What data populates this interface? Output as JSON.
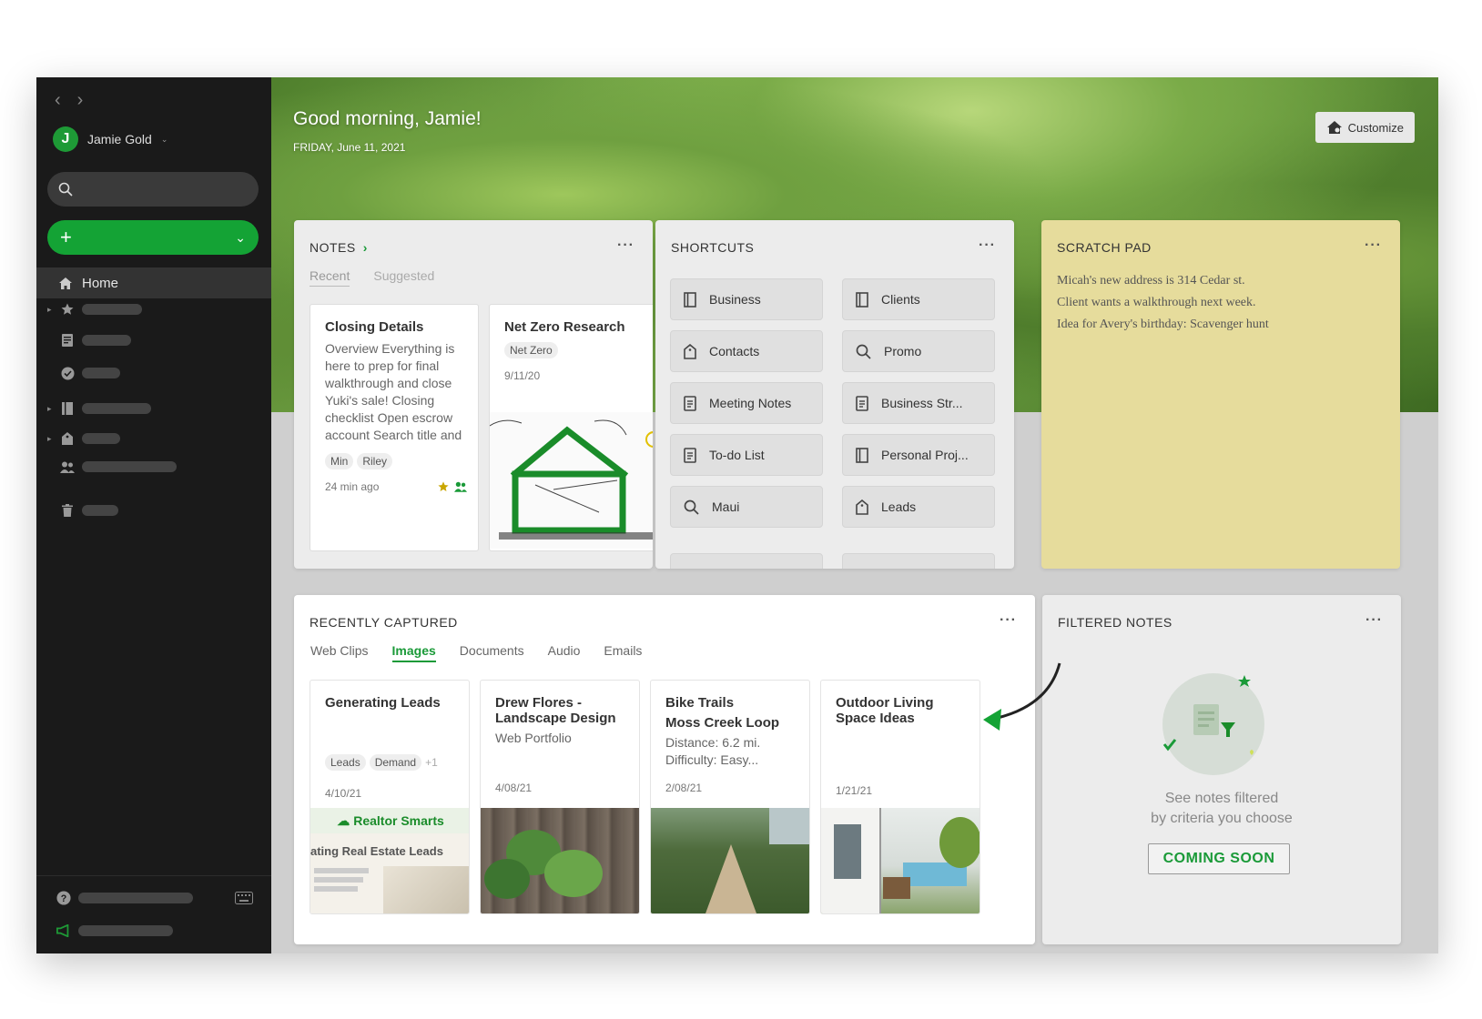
{
  "user": {
    "name": "Jamie Gold",
    "initial": "J"
  },
  "hero": {
    "greeting": "Good morning, Jamie!",
    "date": "FRIDAY, June 11, 2021",
    "customize_label": "Customize"
  },
  "colors": {
    "accent": "#14a335",
    "scratch": "#e6dc9c",
    "sidebar": "#1a1a1a"
  },
  "sidebar": {
    "home_label": "Home"
  },
  "notes": {
    "title": "NOTES",
    "tabs": [
      "Recent",
      "Suggested"
    ],
    "cards": [
      {
        "title": "Closing Details",
        "text": "Overview Everything is here to prep for final walkthrough and close Yuki's sale! Closing checklist Open escrow account Search title and",
        "tags": [
          "Min",
          "Riley"
        ],
        "date": "24 min ago"
      },
      {
        "title": "Net Zero Research",
        "tags": [
          "Net Zero"
        ],
        "date": "9/11/20"
      }
    ]
  },
  "shortcuts": {
    "title": "SHORTCUTS",
    "items": [
      {
        "label": "Business",
        "icon": "notebook-icon"
      },
      {
        "label": "Clients",
        "icon": "notebook-icon"
      },
      {
        "label": "Contacts",
        "icon": "tag-icon"
      },
      {
        "label": "Promo",
        "icon": "search-icon"
      },
      {
        "label": "Meeting Notes",
        "icon": "note-icon"
      },
      {
        "label": "Business Str...",
        "icon": "note-icon"
      },
      {
        "label": "To-do List",
        "icon": "note-icon"
      },
      {
        "label": "Personal Proj...",
        "icon": "notebook-icon"
      },
      {
        "label": "Maui",
        "icon": "search-icon"
      },
      {
        "label": "Leads",
        "icon": "tag-icon"
      }
    ]
  },
  "scratch": {
    "title": "SCRATCH PAD",
    "lines": [
      "Micah's new address is 314 Cedar st.",
      "Client wants a walkthrough next week.",
      "Idea for Avery's birthday: Scavenger hunt"
    ]
  },
  "recent": {
    "title": "RECENTLY CAPTURED",
    "tabs": [
      "Web Clips",
      "Images",
      "Documents",
      "Audio",
      "Emails"
    ],
    "cards": [
      {
        "title": "Generating Leads",
        "tags": [
          "Leads",
          "Demand"
        ],
        "more": "+1",
        "date": "4/10/21",
        "clip_brand": "Realtor Smarts",
        "clip_heading": "ating Real Estate Leads"
      },
      {
        "title": "Drew Flores - Landscape Design",
        "sub": "Web Portfolio",
        "date": "4/08/21"
      },
      {
        "title": "Bike Trails",
        "line2": "Moss Creek Loop",
        "line3": "Distance: 6.2 mi.",
        "line4": "Difficulty: Easy...",
        "date": "2/08/21"
      },
      {
        "title": "Outdoor Living Space Ideas",
        "date": "1/21/21"
      }
    ]
  },
  "filtered": {
    "title": "FILTERED NOTES",
    "line1": "See notes filtered",
    "line2": "by criteria you choose",
    "button": "COMING SOON"
  }
}
